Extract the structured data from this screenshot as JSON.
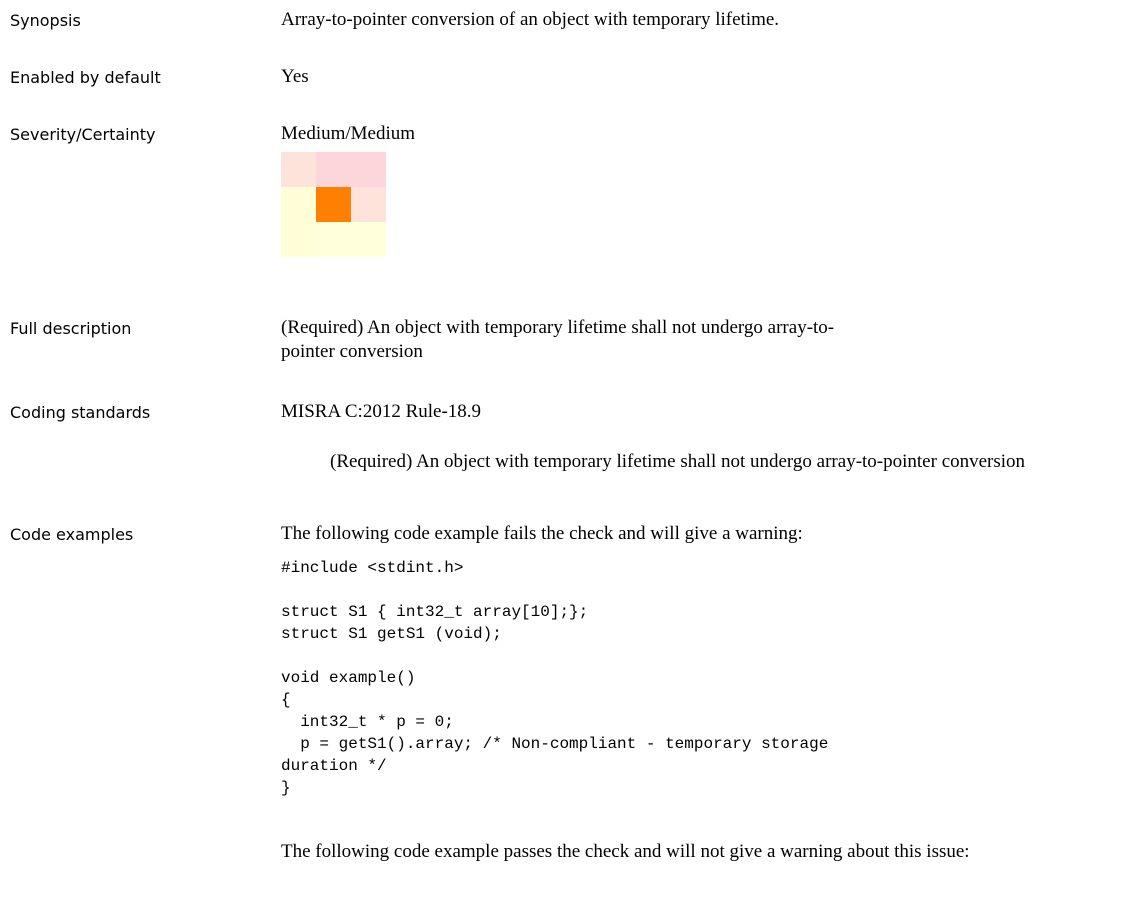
{
  "rows": {
    "synopsis": {
      "label": "Synopsis",
      "value": "Array-to-pointer conversion of an object with temporary lifetime."
    },
    "enabled": {
      "label": "Enabled by default",
      "value": "Yes"
    },
    "severity": {
      "label": "Severity/Certainty",
      "value": "Medium/Medium",
      "matrix_colors": [
        [
          "#fde3d9",
          "#fcd6da",
          "#fcd6da"
        ],
        [
          "#fffed6",
          "#ff8000",
          "#fde3d9"
        ],
        [
          "#fffed6",
          "#ffffdc",
          "#ffffdc"
        ]
      ]
    },
    "full_description": {
      "label": "Full description",
      "value": " (Required) An object with temporary lifetime shall not undergo array-to-pointer conversion"
    },
    "coding_standards": {
      "label": "Coding standards",
      "value": "MISRA C:2012 Rule-18.9",
      "detail": "(Required) An object with temporary lifetime shall not undergo array-to-pointer conversion"
    },
    "code_examples": {
      "label": "Code examples",
      "intro_fail": "The following code example fails the check and will give a warning:",
      "code_fail": "#include <stdint.h>\n\nstruct S1 { int32_t array[10];};\nstruct S1 getS1 (void);\n\nvoid example()\n{\n  int32_t * p = 0;\n  p = getS1().array; /* Non-compliant - temporary storage\nduration */\n}",
      "intro_pass": "The following code example passes the check and will not give a warning about this issue:"
    }
  }
}
